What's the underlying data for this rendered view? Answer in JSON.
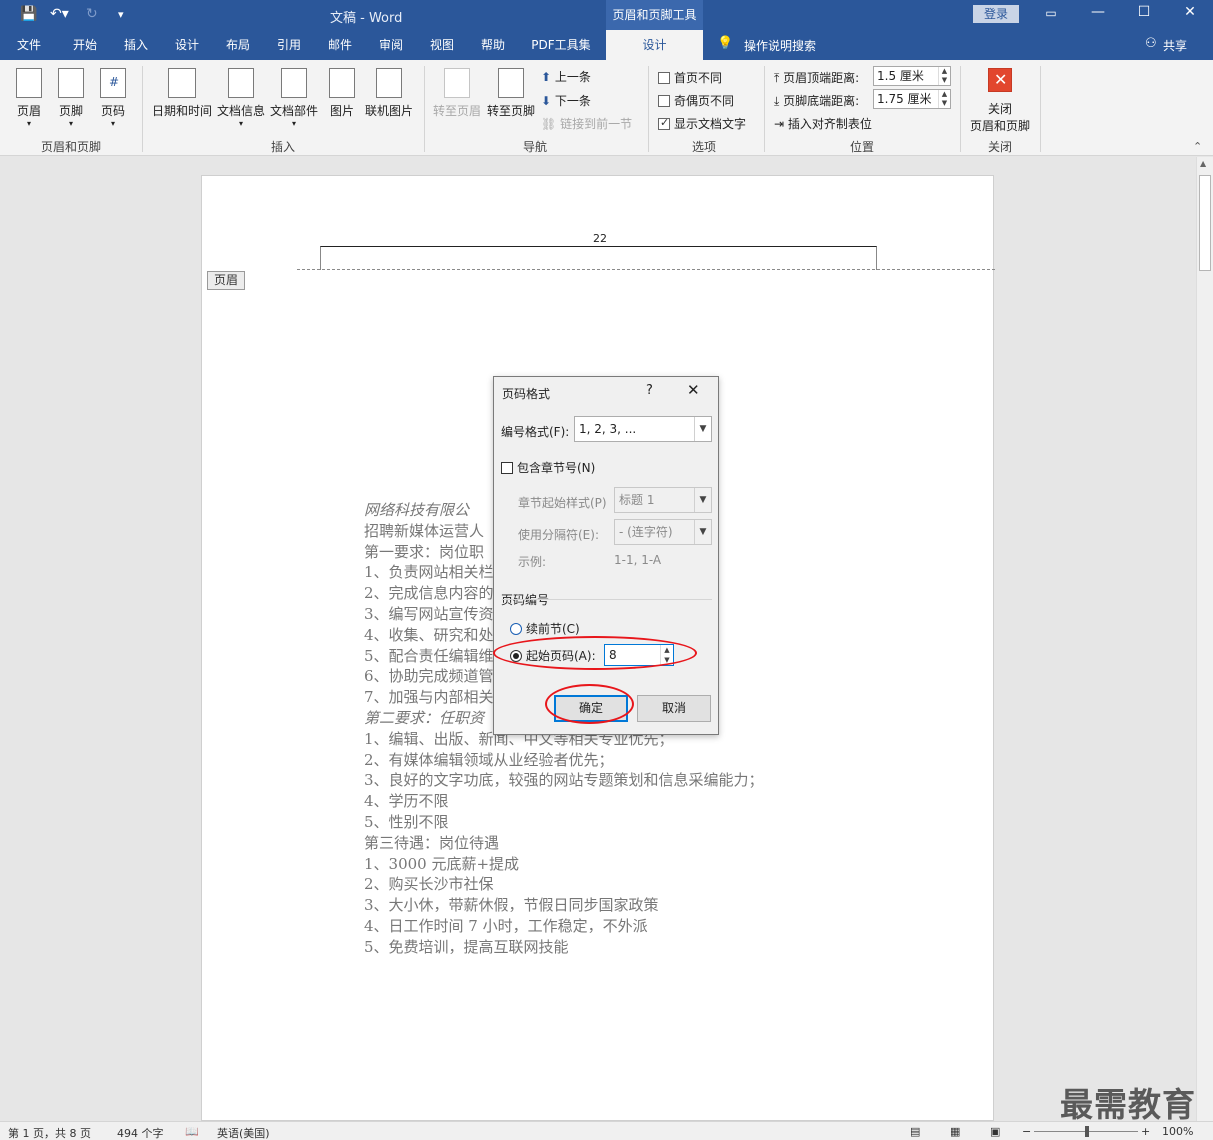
{
  "window": {
    "title": "文稿  -  Word",
    "context_tool": "页眉和页脚工具",
    "login": "登录"
  },
  "tabs": [
    {
      "label": "文件"
    },
    {
      "label": "开始"
    },
    {
      "label": "插入"
    },
    {
      "label": "设计"
    },
    {
      "label": "布局"
    },
    {
      "label": "引用"
    },
    {
      "label": "邮件"
    },
    {
      "label": "审阅"
    },
    {
      "label": "视图"
    },
    {
      "label": "帮助"
    },
    {
      "label": "PDF工具集"
    },
    {
      "label": "设计"
    }
  ],
  "tell_me": "操作说明搜索",
  "share": "共享",
  "ribbon": {
    "group_hf": {
      "label": "页眉和页脚",
      "header": "页眉",
      "footer": "页脚",
      "page_number": "页码"
    },
    "group_insert": {
      "label": "插入",
      "datetime": "日期和时间",
      "docinfo": "文档信息",
      "docparts": "文档部件",
      "picture": "图片",
      "online_picture": "联机图片"
    },
    "group_nav": {
      "label": "导航",
      "goto_header": "转至页眉",
      "goto_footer": "转至页脚",
      "prev": "上一条",
      "next": "下一条",
      "link_prev": "链接到前一节"
    },
    "group_options": {
      "label": "选项",
      "diff_first": "首页不同",
      "diff_odd_even": "奇偶页不同",
      "show_text": "显示文档文字"
    },
    "group_position": {
      "label": "位置",
      "header_top": "页眉顶端距离:",
      "header_top_value": "1.5 厘米",
      "footer_bottom": "页脚底端距离:",
      "footer_bottom_value": "1.75 厘米",
      "insert_align_tab": "插入对齐制表位"
    },
    "group_close": {
      "label": "关闭",
      "close_line1": "关闭",
      "close_line2": "页眉和页脚"
    }
  },
  "document": {
    "header_number": "22",
    "header_tag": "页眉",
    "lines": [
      {
        "text": "    网络科技有限公",
        "italic": true
      },
      {
        "text": "招聘新媒体运营人",
        "italic": false
      },
      {
        "text": "第一要求：岗位职",
        "italic": false
      },
      {
        "text": "1、负责网站相关栏                                                    校等工作；",
        "italic": false
      },
      {
        "text": "2、完成信息内容的",
        "italic": false
      },
      {
        "text": "3、编写网站宣传资",
        "italic": false
      },
      {
        "text": "4、收集、研究和处",
        "italic": false
      },
      {
        "text": "5、配合责任编辑维",
        "italic": false
      },
      {
        "text": "6、协助完成频道管                                                  知名度的提高；",
        "italic": false
      },
      {
        "text": "7、加强与内部相关",
        "italic": false
      },
      {
        "text": "第二要求：任职资",
        "italic": true
      },
      {
        "text": "1、编辑、出版、新闻、中文等相关专业优先；",
        "italic": false
      },
      {
        "text": "2、有媒体编辑领域从业经验者优先；",
        "italic": false
      },
      {
        "text": "3、良好的文字功底，较强的网站专题策划和信息采编能力；",
        "italic": false
      },
      {
        "text": "4、学历不限",
        "italic": false
      },
      {
        "text": "5、性别不限",
        "italic": false
      },
      {
        "text": "第三待遇：岗位待遇",
        "italic": false
      },
      {
        "text": "1、3000 元底薪+提成",
        "italic": false
      },
      {
        "text": "2、购买长沙市社保",
        "italic": false
      },
      {
        "text": "3、大小休，带薪休假，节假日同步国家政策",
        "italic": false
      },
      {
        "text": "4、日工作时间 7 小时，工作稳定，不外派",
        "italic": false
      },
      {
        "text": "5、免费培训，提高互联网技能",
        "italic": false
      }
    ]
  },
  "dialog": {
    "title": "页码格式",
    "help": "?",
    "close": "✕",
    "number_format_label": "编号格式(F):",
    "number_format_value": "1, 2, 3, ...",
    "include_chapter": "包含章节号(N)",
    "chapter_style_label": "章节起始样式(P)",
    "chapter_style_value": "标题 1",
    "separator_label": "使用分隔符(E):",
    "separator_value": "-  (连字符)",
    "example_label": "示例:",
    "example_value": "1-1, 1-A",
    "page_numbering_label": "页码编号",
    "continue_prev": "续前节(C)",
    "start_at": "起始页码(A):",
    "start_value": "8",
    "ok": "确定",
    "cancel": "取消"
  },
  "statusbar": {
    "page": "第 1 页，共 8 页",
    "words": "494 个字",
    "language": "英语(美国)",
    "zoom": "100%"
  },
  "watermark": "最需教育",
  "colors": {
    "accent": "#2b579a",
    "highlight_ellipse": "#e8161b",
    "focus": "#0078d7"
  }
}
